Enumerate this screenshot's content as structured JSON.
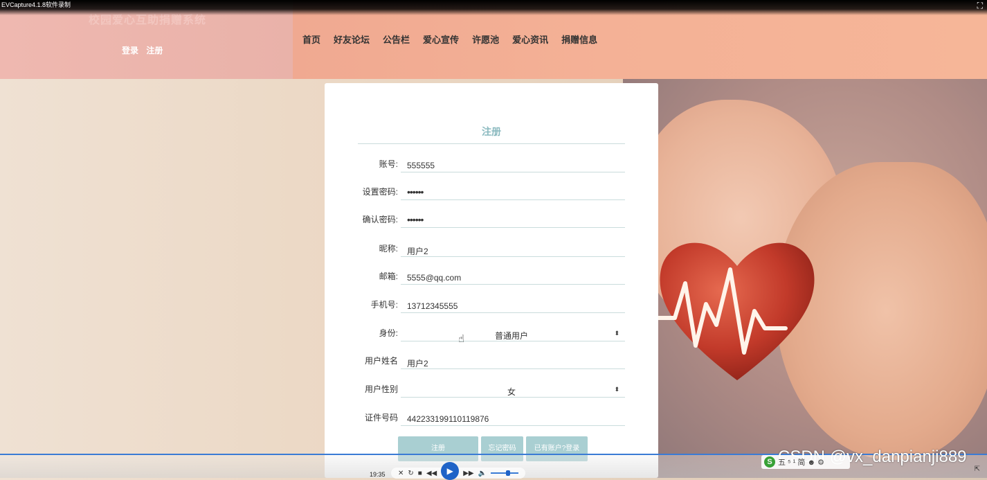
{
  "recorder": {
    "title": "EVCapture4.1.8软件录制",
    "expand_icon": "fullscreen-icon"
  },
  "site": {
    "title": "校园爱心互助捐赠系统"
  },
  "auth": {
    "login": "登录",
    "register": "注册"
  },
  "nav": [
    "首页",
    "好友论坛",
    "公告栏",
    "爱心宣传",
    "许愿池",
    "爱心资讯",
    "捐赠信息"
  ],
  "form": {
    "title": "注册",
    "fields": [
      {
        "label": "账号:",
        "value": "555555",
        "type": "text"
      },
      {
        "label": "设置密码:",
        "value": "••••••",
        "type": "password"
      },
      {
        "label": "确认密码:",
        "value": "••••••",
        "type": "password"
      },
      {
        "label": "昵称:",
        "value": "用户2",
        "type": "text"
      },
      {
        "label": "邮箱:",
        "value": "5555@qq.com",
        "type": "text"
      },
      {
        "label": "手机号:",
        "value": "13712345555",
        "type": "text"
      },
      {
        "label": "身份:",
        "value": "普通用户",
        "type": "select"
      },
      {
        "label": "用户姓名",
        "value": "用户2",
        "type": "text"
      },
      {
        "label": "用户性别",
        "value": "女",
        "type": "select"
      },
      {
        "label": "证件号码",
        "value": "442233199110119876",
        "type": "text"
      }
    ],
    "buttons": {
      "register": "注册",
      "forgot": "忘记密码",
      "have_account": "已有账户?登录"
    }
  },
  "player": {
    "time": "19:35"
  },
  "watermark": "CSDN @vx_danpianji889",
  "ime": {
    "text": "五 ⁵ ¹ 简 ☻ ⚙"
  },
  "colors": {
    "accent": "#a9cfd2",
    "title": "#8ab9bf",
    "header_left": "#efb8b0",
    "header_right": "#f6b698"
  }
}
